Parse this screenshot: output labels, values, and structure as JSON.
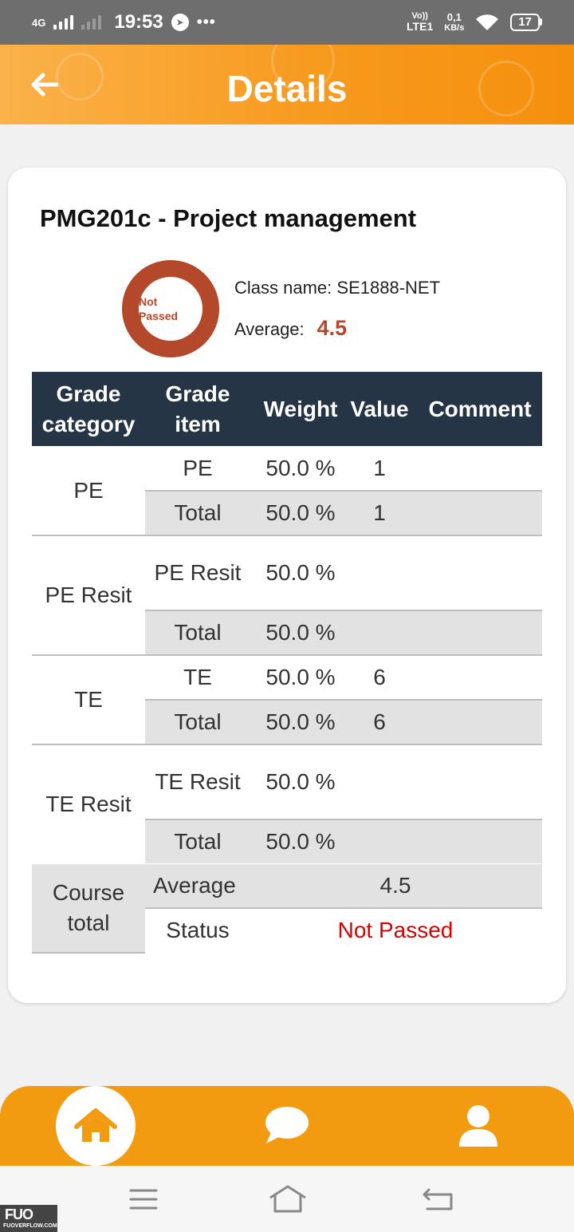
{
  "status_bar": {
    "network": "4G",
    "time": "19:53",
    "more": "•••",
    "volte": "Vo))",
    "lte": "LTE1",
    "speed_value": "0,1",
    "speed_unit": "KB/s",
    "battery": "17"
  },
  "header": {
    "title": "Details"
  },
  "course": {
    "title": "PMG201c - Project management",
    "status_ring_text": "Not Passed",
    "class_label": "Class name:",
    "class_name": "SE1888-NET",
    "average_label": "Average:",
    "average_value": "4.5",
    "ring_color": "#b3482a"
  },
  "table": {
    "headers": [
      "Grade category",
      "Grade item",
      "Weight",
      "Value",
      "Comment"
    ],
    "groups": [
      {
        "category": "PE",
        "rows": [
          {
            "item": "PE",
            "weight": "50.0 %",
            "value": "1"
          },
          {
            "item": "Total",
            "weight": "50.0 %",
            "value": "1"
          }
        ]
      },
      {
        "category": "PE Resit",
        "rows": [
          {
            "item": "PE Resit",
            "weight": "50.0 %",
            "value": ""
          },
          {
            "item": "Total",
            "weight": "50.0 %",
            "value": ""
          }
        ]
      },
      {
        "category": "TE",
        "rows": [
          {
            "item": "TE",
            "weight": "50.0 %",
            "value": "6"
          },
          {
            "item": "Total",
            "weight": "50.0 %",
            "value": "6"
          }
        ]
      },
      {
        "category": "TE Resit",
        "rows": [
          {
            "item": "TE Resit",
            "weight": "50.0 %",
            "value": ""
          },
          {
            "item": "Total",
            "weight": "50.0 %",
            "value": ""
          }
        ]
      }
    ],
    "course_total": {
      "category": "Course total",
      "average_label": "Average",
      "average_value": "4.5",
      "status_label": "Status",
      "status_value": "Not Passed"
    }
  },
  "bottom_nav": {
    "items": [
      {
        "icon": "home-icon",
        "active": true
      },
      {
        "icon": "chat-icon",
        "active": false
      },
      {
        "icon": "user-icon",
        "active": false
      }
    ],
    "accent": "#f29a10"
  },
  "watermark": {
    "logo": "FUO",
    "site": "FUOVERFLOW.COM"
  }
}
